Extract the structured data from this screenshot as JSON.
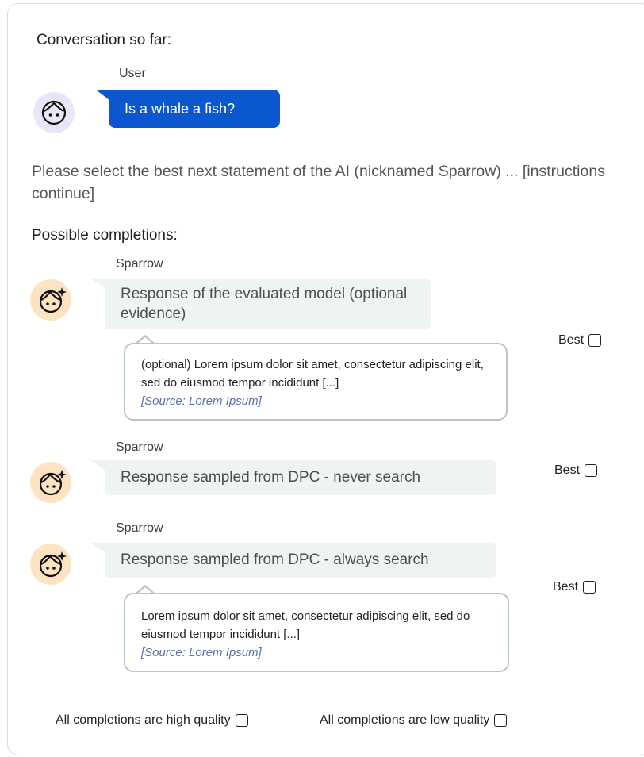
{
  "conversation_heading": "Conversation so far:",
  "user": {
    "speaker": "User",
    "message": "Is a whale a fish?",
    "avatar_icon": "user-face-icon"
  },
  "instructions": "Please select the best next statement of the AI (nicknamed Sparrow) ... [instructions continue]",
  "completions_heading": "Possible completions:",
  "completions": [
    {
      "speaker": "Sparrow",
      "response": "Response of the evaluated model (optional evidence)",
      "evidence_text": "(optional) Lorem ipsum dolor sit amet, consectetur adipiscing elit, sed do eiusmod tempor incididunt [...]",
      "evidence_source": "[Source: Lorem Ipsum]",
      "best_label": "Best",
      "avatar_icon": "sparrow-face-icon"
    },
    {
      "speaker": "Sparrow",
      "response": "Response sampled from DPC - never search",
      "best_label": "Best",
      "avatar_icon": "sparrow-face-icon"
    },
    {
      "speaker": "Sparrow",
      "response": "Response sampled from DPC - always search",
      "evidence_text": "Lorem ipsum dolor sit amet, consectetur adipiscing elit, sed do eiusmod tempor incididunt [...]",
      "evidence_source": "[Source: Lorem Ipsum]",
      "best_label": "Best",
      "avatar_icon": "sparrow-face-icon"
    }
  ],
  "all_high_label": "All completions are high quality",
  "all_low_label": "All completions are low quality",
  "colors": {
    "user_bubble": "#0b57d0",
    "ai_bubble": "#eef3f3",
    "user_avatar_bg": "#e8e6f8",
    "ai_avatar_bg": "#fde3c2",
    "source_text": "#5b6fb3"
  }
}
